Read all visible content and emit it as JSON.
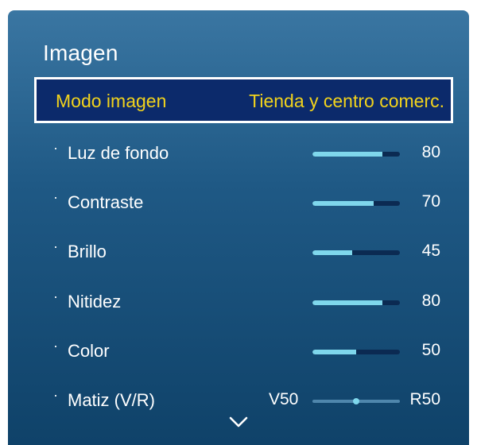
{
  "menu": {
    "title": "Imagen",
    "mode": {
      "label": "Modo imagen",
      "value": "Tienda y centro comerc."
    },
    "items": [
      {
        "label": "Luz de fondo",
        "value": "80",
        "level": 0.8
      },
      {
        "label": "Contraste",
        "value": "70",
        "level": 0.7
      },
      {
        "label": "Brillo",
        "value": "45",
        "level": 0.45
      },
      {
        "label": "Nitidez",
        "value": "80",
        "level": 0.8
      },
      {
        "label": "Color",
        "value": "50",
        "level": 0.5
      }
    ],
    "tint": {
      "label": "Matiz (V/R)",
      "left": "V50",
      "right": "R50",
      "level": 0.5
    },
    "bullet": "·"
  },
  "icons": {
    "more": "chevron-down-icon"
  },
  "colors": {
    "highlight_text": "#f2d31c",
    "highlight_bg": "#0c2a6b",
    "slider_fill": "#7fd7ec"
  }
}
